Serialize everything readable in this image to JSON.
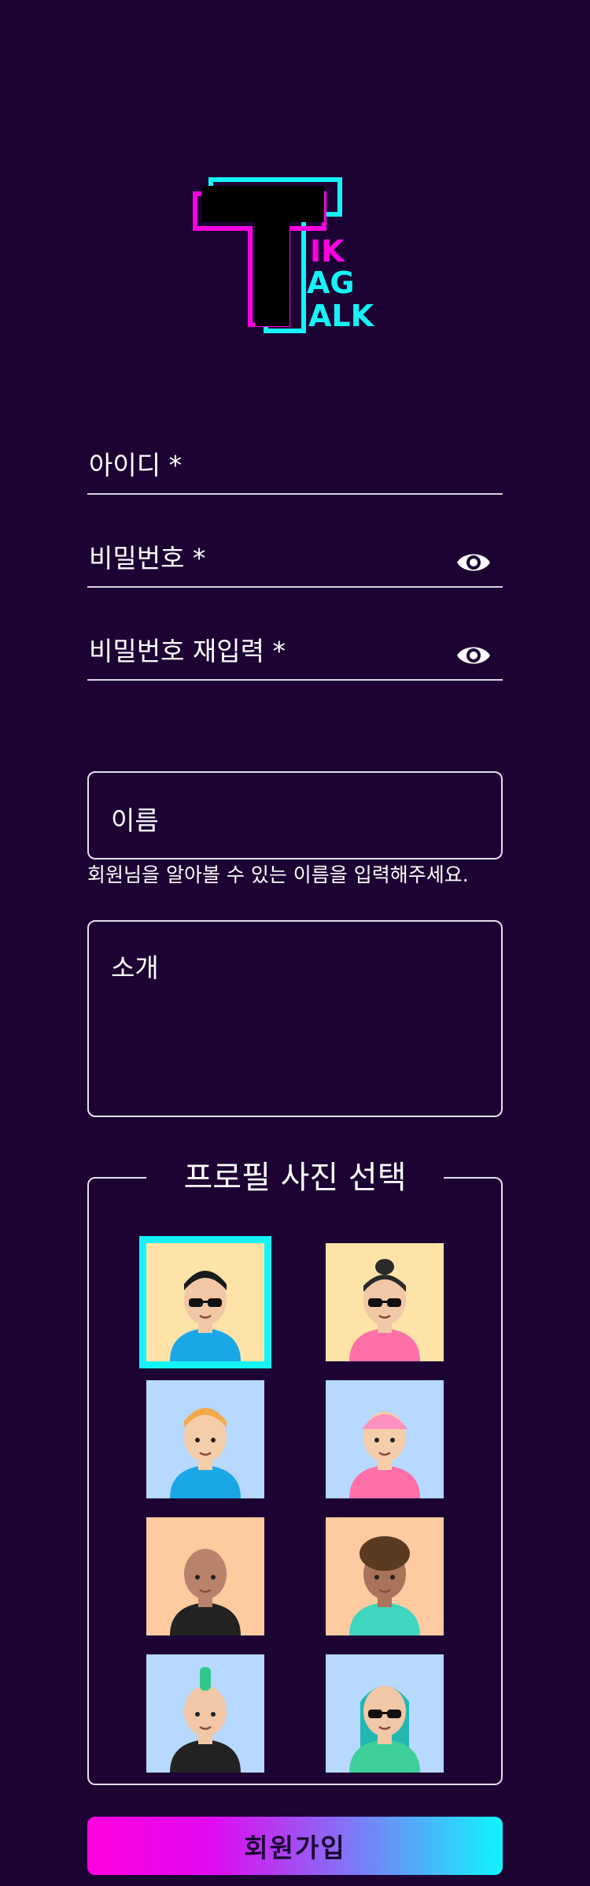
{
  "logo": {
    "big_letter": "T",
    "line1": "IK",
    "line2": "AG",
    "line3": "ALK"
  },
  "form": {
    "id_label": "아이디 *",
    "password_label": "비밀번호 *",
    "password_confirm_label": "비밀번호 재입력 *",
    "name_placeholder": "이름",
    "name_helper": "회원님을 알아볼 수 있는 이름을 입력해주세요.",
    "intro_placeholder": "소개"
  },
  "profile": {
    "legend": "프로필 사진 선택",
    "selected_index": 0,
    "avatars": [
      {
        "name": "man-sunglasses-blue-shirt",
        "bg": "#fde3a7"
      },
      {
        "name": "woman-sunglasses-pink-shirt",
        "bg": "#fde3a7"
      },
      {
        "name": "boy-orange-hair-blue-shirt",
        "bg": "#b7d8ff"
      },
      {
        "name": "girl-pink-hat",
        "bg": "#b7d8ff"
      },
      {
        "name": "bald-man-suit",
        "bg": "#ffcaa0"
      },
      {
        "name": "curly-hair-tank-top",
        "bg": "#ffcaa0"
      },
      {
        "name": "punk-mohawk-leather-jacket",
        "bg": "#b7d8ff"
      },
      {
        "name": "teal-hair-woman-sunglasses",
        "bg": "#b7d8ff"
      }
    ]
  },
  "actions": {
    "signup_label": "회원가입"
  },
  "colors": {
    "background": "#1c0333",
    "accent_cyan": "#15f3f7",
    "accent_magenta": "#ff00e1"
  }
}
